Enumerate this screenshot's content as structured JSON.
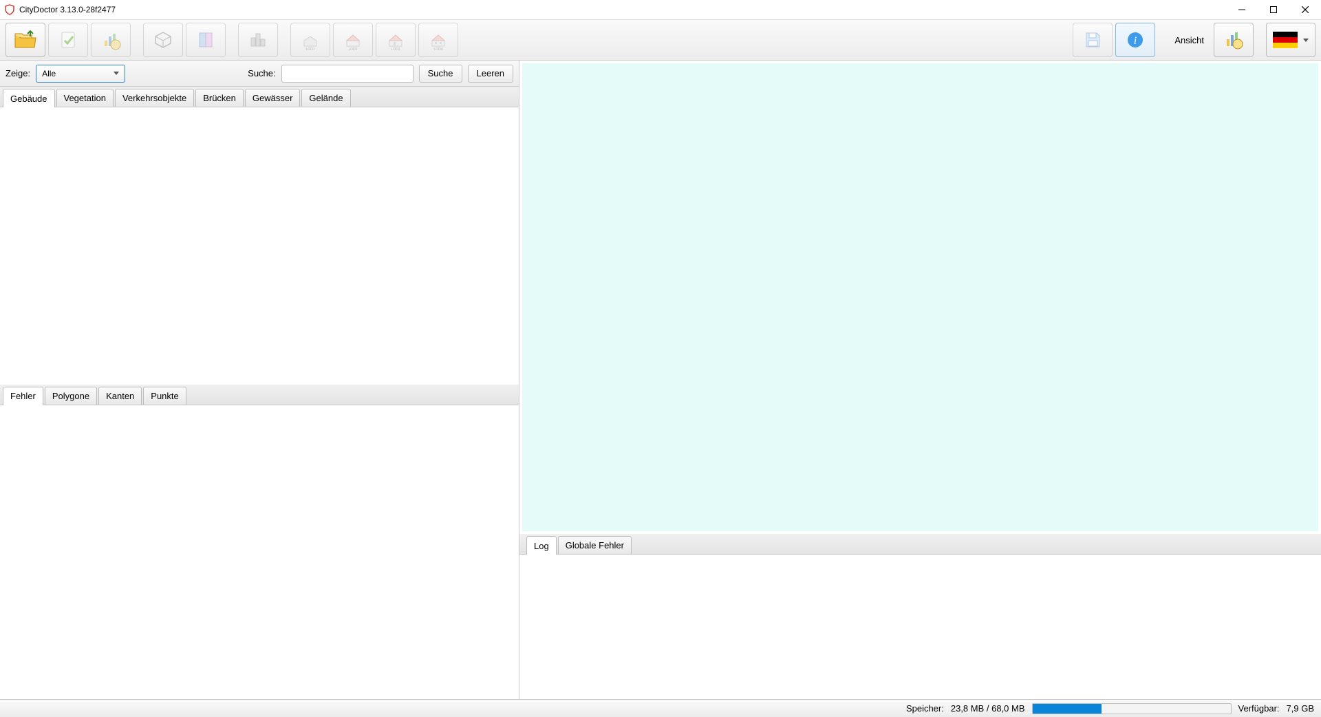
{
  "window": {
    "title": "CityDoctor 3.13.0-28f2477"
  },
  "toolbar": {
    "ansicht": "Ansicht"
  },
  "filter": {
    "zeige_label": "Zeige:",
    "zeige_value": "Alle",
    "suche_label": "Suche:",
    "suche_value": "",
    "suche_button": "Suche",
    "leeren_button": "Leeren"
  },
  "tree_tabs": {
    "items": [
      "Gebäude",
      "Vegetation",
      "Verkehrsobjekte",
      "Brücken",
      "Gewässer",
      "Gelände"
    ],
    "active": 0
  },
  "detail_tabs": {
    "items": [
      "Fehler",
      "Polygone",
      "Kanten",
      "Punkte"
    ],
    "active": 0
  },
  "log_tabs": {
    "items": [
      "Log",
      "Globale Fehler"
    ],
    "active": 0
  },
  "status": {
    "speicher_label": "Speicher:",
    "speicher_value": "23,8 MB / 68,0 MB",
    "verfuegbar_label": "Verfügbar:",
    "verfuegbar_value": "7,9 GB"
  }
}
